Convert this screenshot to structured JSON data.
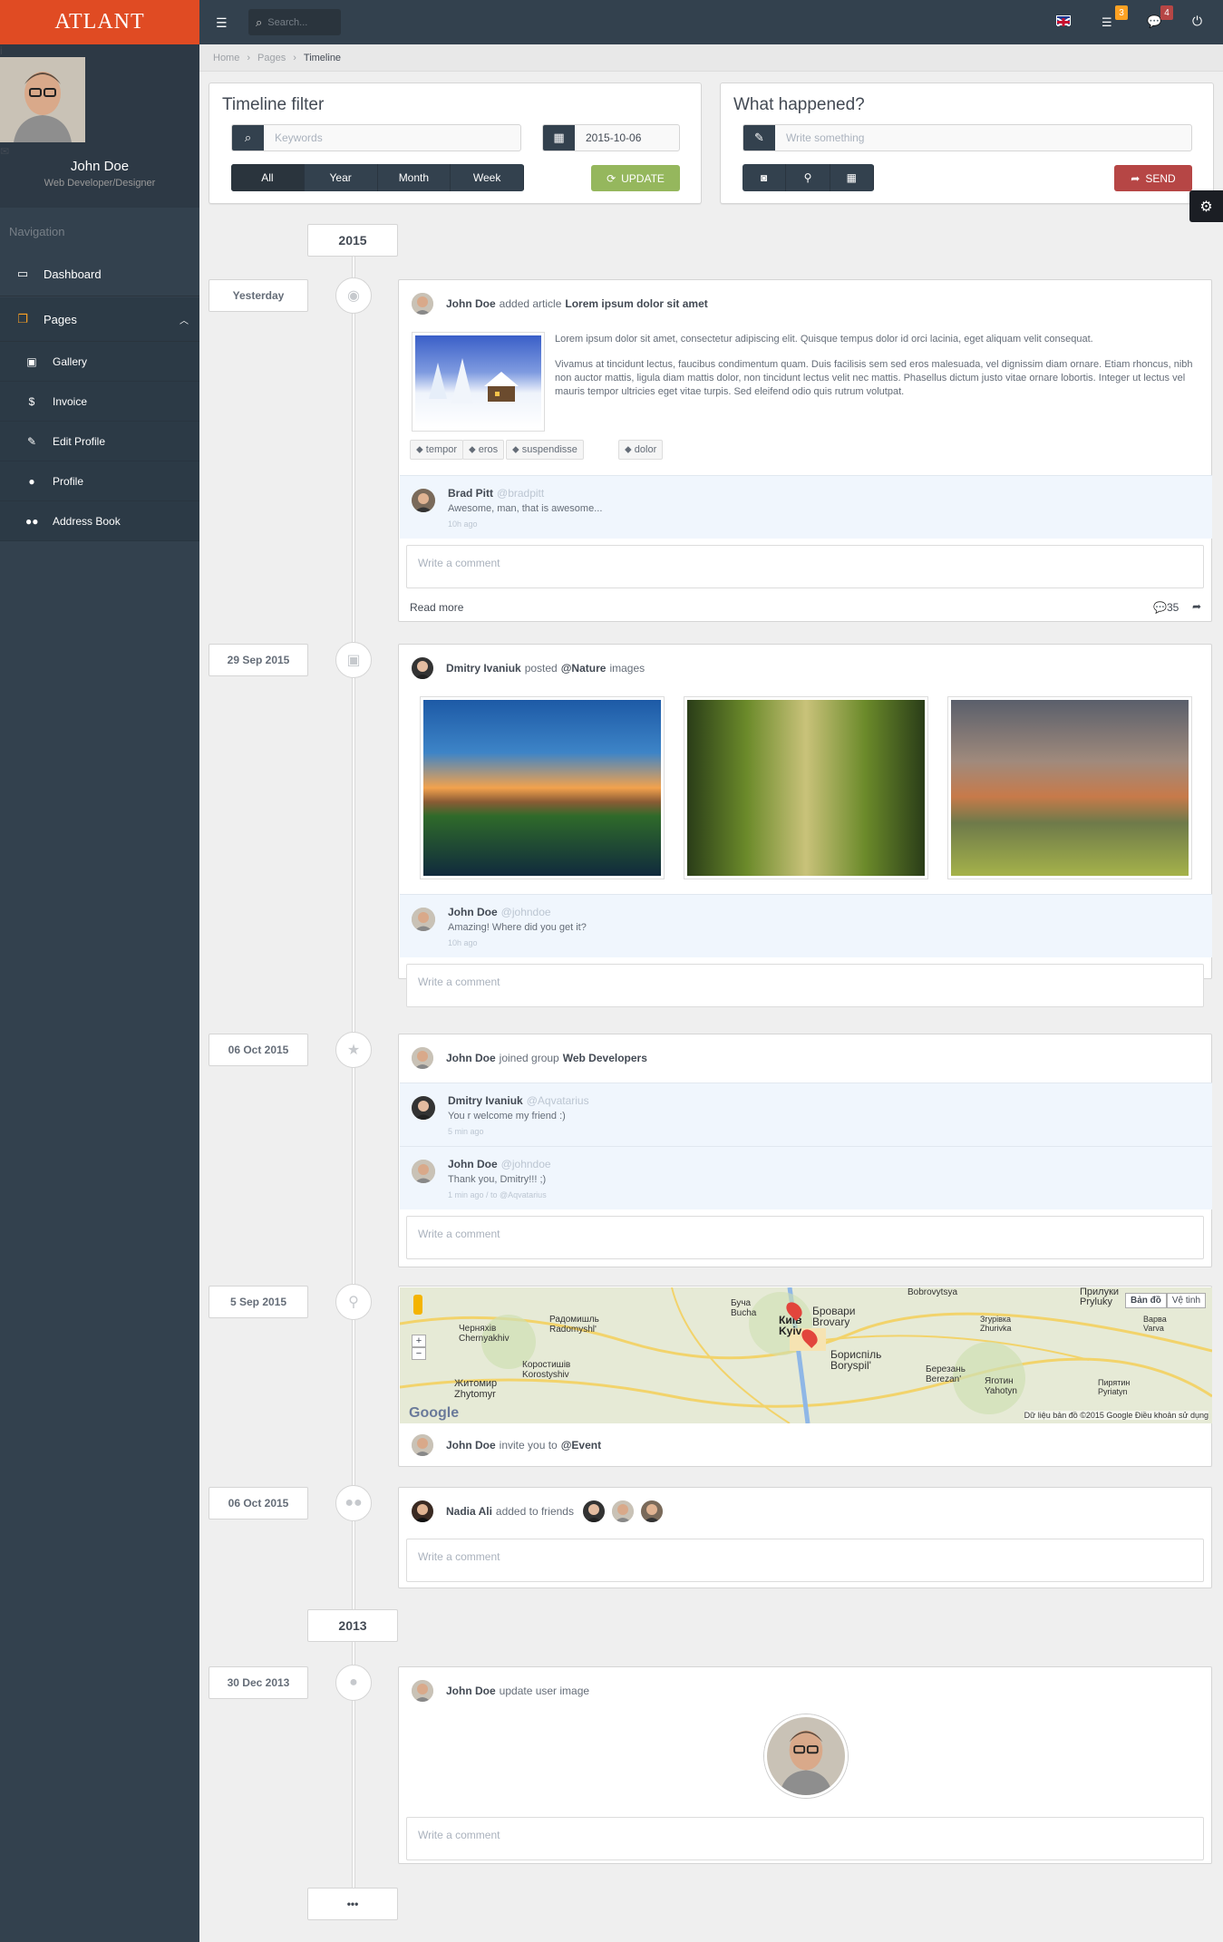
{
  "app": {
    "logo": "ATLANT"
  },
  "user": {
    "name": "John Doe",
    "role": "Web Developer/Designer"
  },
  "nav": {
    "title": "Navigation",
    "items": [
      {
        "label": "Dashboard",
        "icon": "desktop-icon"
      },
      {
        "label": "Pages",
        "icon": "files-icon"
      }
    ],
    "sub": [
      {
        "label": "Gallery",
        "icon": "image-icon"
      },
      {
        "label": "Invoice",
        "icon": "dollar-icon"
      },
      {
        "label": "Edit Profile",
        "icon": "wrench-icon"
      },
      {
        "label": "Profile",
        "icon": "user-icon"
      },
      {
        "label": "Address Book",
        "icon": "users-icon"
      }
    ]
  },
  "topbar": {
    "search_placeholder": "Search...",
    "tasks_badge": "3",
    "messages_badge": "4"
  },
  "breadcrumb": [
    "Home",
    "Pages",
    "Timeline"
  ],
  "filter": {
    "title": "Timeline filter",
    "keywords_placeholder": "Keywords",
    "date": "2015-10-06",
    "ranges": [
      "All",
      "Year",
      "Month",
      "Week"
    ],
    "update_label": "UPDATE"
  },
  "post": {
    "title": "What happened?",
    "placeholder": "Write something",
    "send_label": "SEND"
  },
  "timeline": {
    "years": [
      "2015",
      "2013"
    ],
    "more": "•••",
    "comment_placeholder": "Write a comment",
    "items": [
      {
        "date": "Yesterday",
        "author": "John Doe",
        "action": "added article",
        "target": "Lorem ipsum dolor sit amet",
        "p1": "Lorem ipsum dolor sit amet, consectetur adipiscing elit. Quisque tempus dolor id orci lacinia, eget aliquam velit consequat.",
        "p2": "Vivamus at tincidunt lectus, faucibus condimentum quam. Duis facilisis sem sed eros malesuada, vel dignissim diam ornare. Etiam rhoncus, nibh non auctor mattis, ligula diam mattis dolor, non tincidunt lectus velit nec mattis. Phasellus dictum justo vitae ornare lobortis. Integer ut lectus vel mauris tempor ultricies eget vitae turpis. Sed eleifend odio quis rutrum volutpat.",
        "tags": [
          "tempor",
          "eros",
          "suspendisse",
          "dolor"
        ],
        "comment": {
          "name": "Brad Pitt",
          "handle": "@bradpitt",
          "text": "Awesome, man, that is awesome...",
          "time": "10h ago"
        },
        "read_more": "Read more",
        "comments_count": "35"
      },
      {
        "date": "29 Sep 2015",
        "author": "Dmitry Ivaniuk",
        "action": "posted",
        "target": "@Nature",
        "suffix": "images",
        "comment": {
          "name": "John Doe",
          "handle": "@johndoe",
          "text": "Amazing! Where did you get it?",
          "time": "10h ago"
        }
      },
      {
        "date": "06 Oct 2015",
        "author": "John Doe",
        "action": "joined group",
        "target": "Web Developers",
        "comments": [
          {
            "name": "Dmitry Ivaniuk",
            "handle": "@Aqvatarius",
            "text": "You r welcome my friend :)",
            "time": "5 min ago"
          },
          {
            "name": "John Doe",
            "handle": "@johndoe",
            "text": "Thank you, Dmitry!!! ;)",
            "time": "1 min ago / to @Aqvatarius"
          }
        ]
      },
      {
        "date": "5 Sep 2015",
        "author": "John Doe",
        "action": "invite you to",
        "target": "@Event",
        "map": {
          "btn_map": "Bản đồ",
          "btn_sat": "Vệ tinh",
          "footer": "Dữ liệu bản đồ ©2015 Google   Điều khoản sử dụng",
          "labels": [
            "Житомир Zhytomyr",
            "Коростишів Korostyshiv",
            "Київ Kyiv",
            "Бровари Brovary",
            "Бориспіль Boryspil'",
            "Березань Berezan'",
            "Яготин Yahotyn",
            "Прилуки Pryluky",
            "Bobrovytsya",
            "Буча Bucha",
            "Радомишль Radomyshl'",
            "Черняхів Chernyakhiv",
            "Згурівка Zhurivka",
            "Варва Varva",
            "Пирятин Pyriatyn"
          ]
        }
      },
      {
        "date": "06 Oct 2015",
        "author": "Nadia Ali",
        "action": "added to friends"
      },
      {
        "date": "30 Dec 2013",
        "author": "John Doe",
        "action": "update user image"
      }
    ]
  },
  "colors": {
    "sidebar": "#33414e",
    "logo": "#e04b23",
    "update": "#95b75d",
    "send": "#b64645",
    "accent": "#fea223"
  }
}
